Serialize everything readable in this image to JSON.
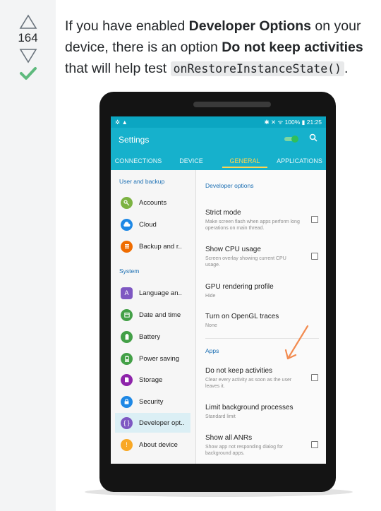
{
  "vote": {
    "score": "164",
    "upvote_icon": "triangle-up-icon",
    "downvote_icon": "triangle-down-icon",
    "accepted_icon": "checkmark-icon",
    "accepted_color": "#2f9e44"
  },
  "answer": {
    "part1": "If you have enabled ",
    "bold1": "Developer Options",
    "part2": " on your device, there is an option ",
    "bold2": "Do not keep activities",
    "part3": " that will help test ",
    "code": "onRestoreInstanceState()",
    "part4": "."
  },
  "device": {
    "status": {
      "left_icons": "✲ ▲",
      "right": "✱ ✕ ᯤ 100% ▮ 21:25"
    },
    "app_title": "Settings",
    "tabs": [
      {
        "label": "CONNECTIONS",
        "active": false
      },
      {
        "label": "DEVICE",
        "active": false
      },
      {
        "label": "GENERAL",
        "active": true
      },
      {
        "label": "APPLICATIONS",
        "active": false
      }
    ],
    "left": {
      "section1": "User and backup",
      "section2": "System",
      "items": [
        {
          "label": "Accounts",
          "icon": "key-icon",
          "color": "#7cb342"
        },
        {
          "label": "Cloud",
          "icon": "cloud-icon",
          "color": "#1e88e5"
        },
        {
          "label": "Backup and r..",
          "icon": "backup-icon",
          "color": "#ef6c00"
        },
        {
          "label": "Language an..",
          "icon": "language-icon",
          "color": "#7e57c2"
        },
        {
          "label": "Date and time",
          "icon": "calendar-icon",
          "color": "#43a047"
        },
        {
          "label": "Battery",
          "icon": "battery-icon",
          "color": "#43a047"
        },
        {
          "label": "Power saving",
          "icon": "power-saving-icon",
          "color": "#43a047"
        },
        {
          "label": "Storage",
          "icon": "storage-icon",
          "color": "#8e24aa"
        },
        {
          "label": "Security",
          "icon": "lock-icon",
          "color": "#1e88e5"
        },
        {
          "label": "Developer opt..",
          "icon": "developer-icon",
          "color": "#7e57c2"
        },
        {
          "label": "About device",
          "icon": "info-icon",
          "color": "#f9a825"
        }
      ]
    },
    "right": {
      "header1": "Developer options",
      "header2": "Apps",
      "items": [
        {
          "title": "Strict mode",
          "sub": "Make screen flash when apps perform long operations on main thread.",
          "checkbox": true
        },
        {
          "title": "Show CPU usage",
          "sub": "Screen overlay showing current CPU usage.",
          "checkbox": true
        },
        {
          "title": "GPU rendering profile",
          "sub": "Hide",
          "checkbox": false
        },
        {
          "title": "Turn on OpenGL traces",
          "sub": "None",
          "checkbox": false
        },
        {
          "title": "Do not keep activities",
          "sub": "Clear every activity as soon as the user leaves it.",
          "checkbox": true
        },
        {
          "title": "Limit background processes",
          "sub": "Standard limit",
          "checkbox": false
        },
        {
          "title": "Show all ANRs",
          "sub": "Show app not responding dialog for background apps.",
          "checkbox": true
        }
      ]
    },
    "annotation_color": "#f28b50"
  }
}
